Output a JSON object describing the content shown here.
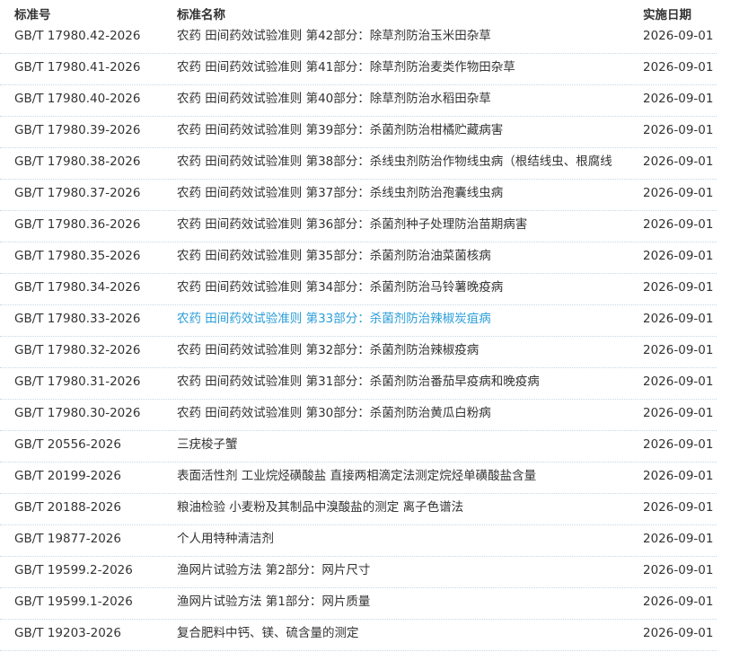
{
  "header": {
    "code": "标准号",
    "name": "标准名称",
    "date": "实施日期"
  },
  "accent_color": "#2b9ed8",
  "rows": [
    {
      "code": "GB/T 17980.42-2026",
      "name": "农药 田间药效试验准则 第42部分：除草剂防治玉米田杂草",
      "date": "2026-09-01"
    },
    {
      "code": "GB/T 17980.41-2026",
      "name": "农药 田间药效试验准则 第41部分：除草剂防治麦类作物田杂草",
      "date": "2026-09-01"
    },
    {
      "code": "GB/T 17980.40-2026",
      "name": "农药 田间药效试验准则 第40部分：除草剂防治水稻田杂草",
      "date": "2026-09-01"
    },
    {
      "code": "GB/T 17980.39-2026",
      "name": "农药 田间药效试验准则 第39部分：杀菌剂防治柑橘贮藏病害",
      "date": "2026-09-01"
    },
    {
      "code": "GB/T 17980.38-2026",
      "name": "农药 田间药效试验准则 第38部分：杀线虫剂防治作物线虫病（根结线虫、根腐线",
      "date": "2026-09-01"
    },
    {
      "code": "GB/T 17980.37-2026",
      "name": "农药 田间药效试验准则 第37部分：杀线虫剂防治孢囊线虫病",
      "date": "2026-09-01"
    },
    {
      "code": "GB/T 17980.36-2026",
      "name": "农药 田间药效试验准则 第36部分：杀菌剂种子处理防治苗期病害",
      "date": "2026-09-01"
    },
    {
      "code": "GB/T 17980.35-2026",
      "name": "农药 田间药效试验准则 第35部分：杀菌剂防治油菜菌核病",
      "date": "2026-09-01"
    },
    {
      "code": "GB/T 17980.34-2026",
      "name": "农药 田间药效试验准则 第34部分：杀菌剂防治马铃薯晚疫病",
      "date": "2026-09-01"
    },
    {
      "code": "GB/T 17980.33-2026",
      "name": "农药 田间药效试验准则 第33部分：杀菌剂防治辣椒炭疽病",
      "date": "2026-09-01",
      "highlight": true
    },
    {
      "code": "GB/T 17980.32-2026",
      "name": "农药 田间药效试验准则 第32部分：杀菌剂防治辣椒疫病",
      "date": "2026-09-01"
    },
    {
      "code": "GB/T 17980.31-2026",
      "name": "农药 田间药效试验准则 第31部分：杀菌剂防治番茄早疫病和晚疫病",
      "date": "2026-09-01"
    },
    {
      "code": "GB/T 17980.30-2026",
      "name": "农药 田间药效试验准则 第30部分：杀菌剂防治黄瓜白粉病",
      "date": "2026-09-01"
    },
    {
      "code": "GB/T 20556-2026",
      "name": "三疣梭子蟹",
      "date": "2026-09-01"
    },
    {
      "code": "GB/T 20199-2026",
      "name": "表面活性剂 工业烷烃磺酸盐 直接两相滴定法测定烷烃单磺酸盐含量",
      "date": "2026-09-01"
    },
    {
      "code": "GB/T 20188-2026",
      "name": "粮油检验 小麦粉及其制品中溴酸盐的测定 离子色谱法",
      "date": "2026-09-01"
    },
    {
      "code": "GB/T 19877-2026",
      "name": "个人用特种清洁剂",
      "date": "2026-09-01"
    },
    {
      "code": "GB/T 19599.2-2026",
      "name": "渔网片试验方法 第2部分：网片尺寸",
      "date": "2026-09-01"
    },
    {
      "code": "GB/T 19599.1-2026",
      "name": "渔网片试验方法 第1部分：网片质量",
      "date": "2026-09-01"
    },
    {
      "code": "GB/T 19203-2026",
      "name": "复合肥料中钙、镁、硫含量的测定",
      "date": "2026-09-01"
    }
  ]
}
